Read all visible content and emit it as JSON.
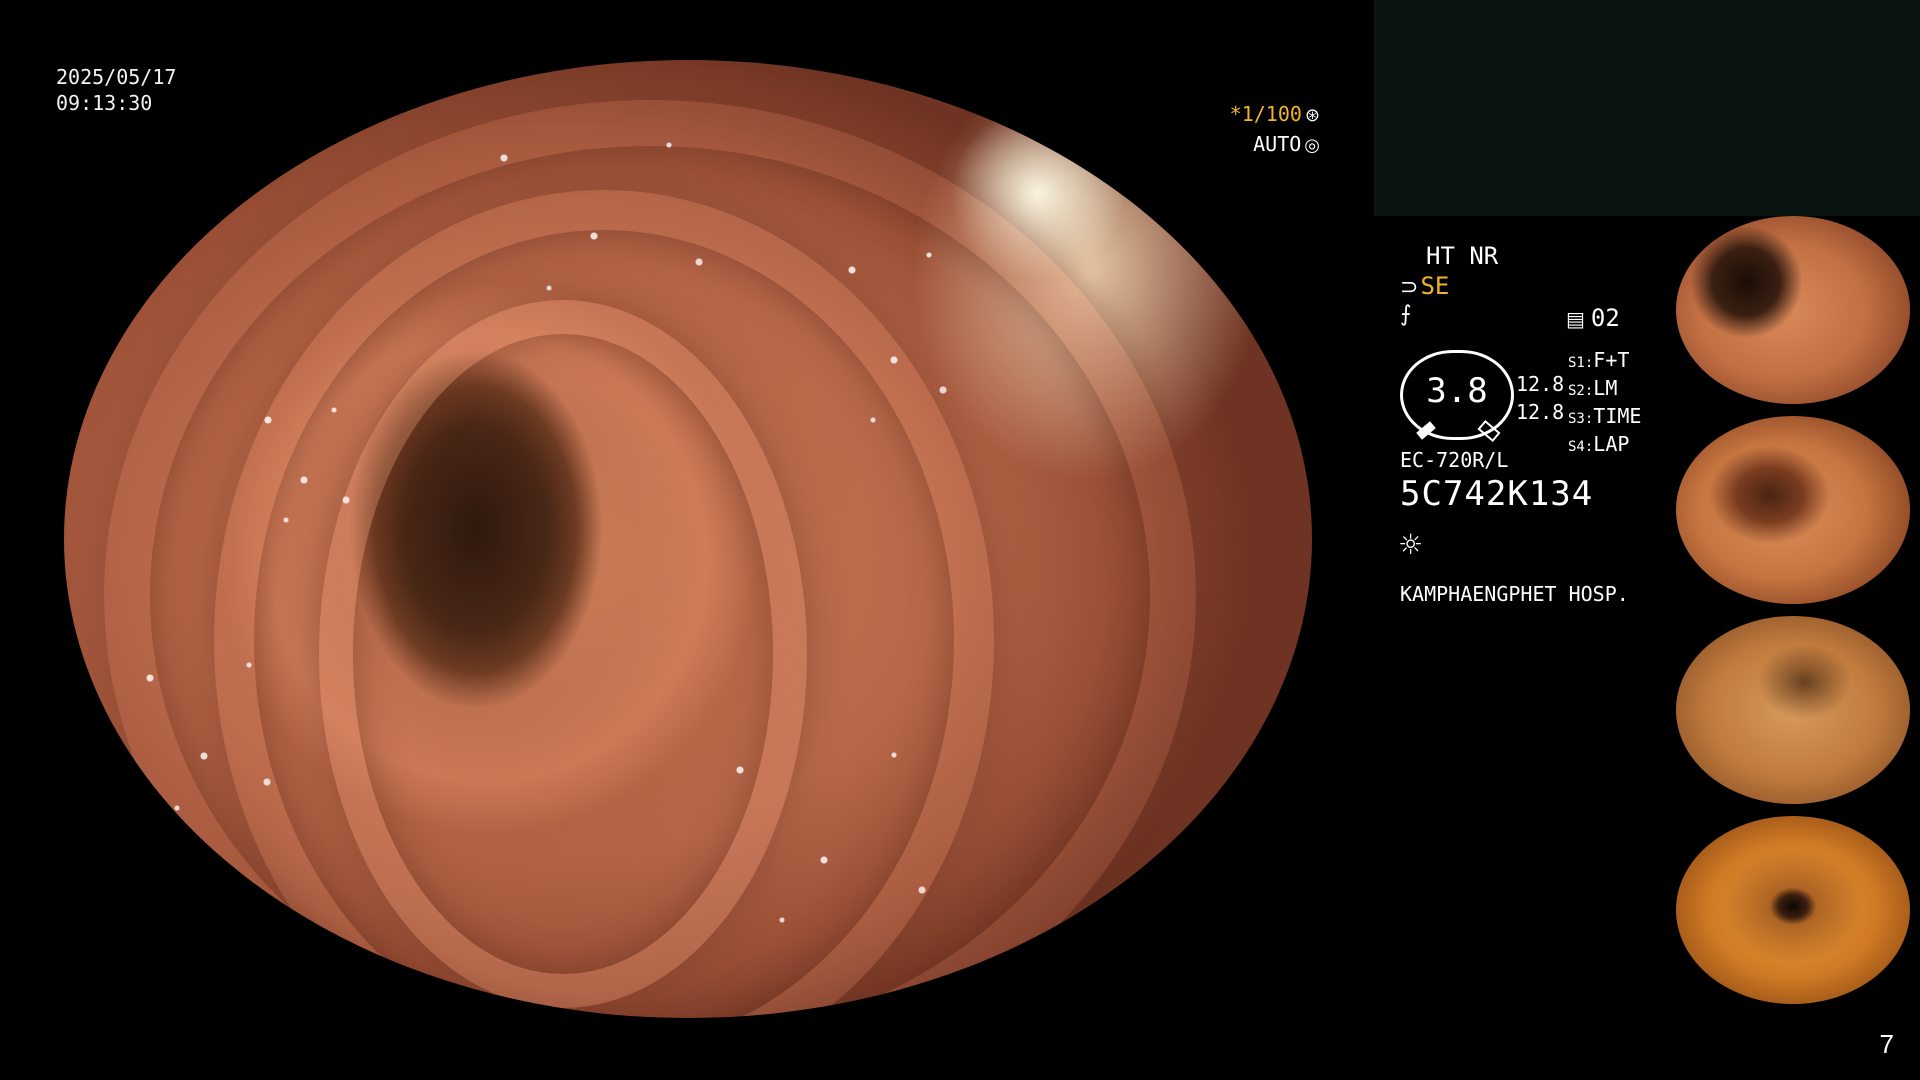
{
  "overlay": {
    "date": "2025/05/17",
    "time": "09:13:30",
    "shutter": "*1/100",
    "auto": "AUTO"
  },
  "status": {
    "ht_nr": "HT NR",
    "mode": "SE",
    "record_num": "02",
    "gauge_value": "3.8",
    "gauge_side_top": "12.8",
    "gauge_side_bottom": "12.8",
    "s_items": [
      {
        "key": "S1:",
        "value": "F+T"
      },
      {
        "key": "S2:",
        "value": "LM"
      },
      {
        "key": "S3:",
        "value": "TIME"
      },
      {
        "key": "S4:",
        "value": "LAP"
      }
    ],
    "model": "EC-720R/L",
    "serial": "5C742K134",
    "hospital": "KAMPHAENGPHET HOSP."
  },
  "page_number": "7",
  "icons": {
    "shutter": "aperture-icon",
    "auto": "auto-iris-icon",
    "mode": "scope-icon",
    "filter": "filter-icon",
    "record": "record-icon",
    "light": "light-icon"
  }
}
